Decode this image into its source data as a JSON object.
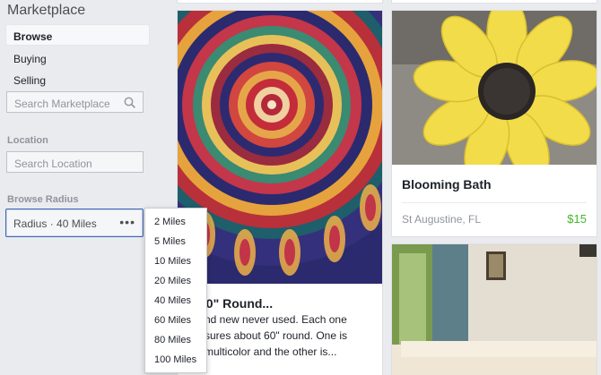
{
  "sidebar": {
    "title": "Marketplace",
    "nav": [
      {
        "label": "Browse"
      },
      {
        "label": "Buying"
      },
      {
        "label": "Selling"
      }
    ],
    "search": {
      "placeholder": "Search Marketplace"
    },
    "location": {
      "label": "Location",
      "placeholder": "Search Location"
    },
    "radius": {
      "label": "Browse Radius",
      "value": "Radius · 40 Miles",
      "options": [
        "2 Miles",
        "5 Miles",
        "10 Miles",
        "20 Miles",
        "40 Miles",
        "60 Miles",
        "80 Miles",
        "100 Miles"
      ]
    }
  },
  "listings": [
    {
      "title": "60\" Round...",
      "description": [
        "nd new never used. Each one",
        "sures about 60\" round. One is",
        "multicolor and the other is..."
      ]
    },
    {
      "title": "Blooming Bath",
      "location": "St Augustine, FL",
      "price": "$15"
    }
  ],
  "colors": {
    "accent": "#4267b2",
    "price": "#42b72a"
  }
}
